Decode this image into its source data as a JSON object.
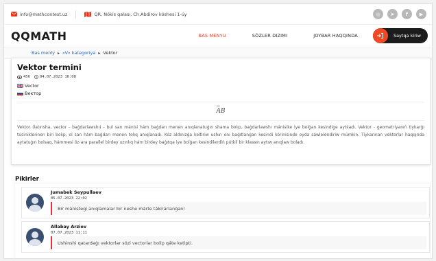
{
  "topbar": {
    "email": "info@mathcontest.uz",
    "address": "QR, Nókis qalası, Ch.Abdirov kóshesi 1-úy",
    "social": [
      "instagram-icon",
      "telegram-icon",
      "facebook-icon",
      "youtube-icon"
    ]
  },
  "header": {
    "logo": "QQMATH",
    "nav": [
      {
        "label": "BAS MENYU",
        "active": true
      },
      {
        "label": "SÓZLER DIZIMI",
        "active": false
      },
      {
        "label": "JOYBAR HAQQINDA",
        "active": false
      }
    ],
    "login_label": "Saytqa kiriw"
  },
  "breadcrumb": {
    "home": "Bas menly",
    "category": "«V» kategoriya",
    "current": "Vektor"
  },
  "term": {
    "title": "Vektor termini",
    "views": "456",
    "date": "04.07.2023 16:08",
    "translations": {
      "en": "Vector",
      "ru": "Вектор"
    },
    "formula": "AB",
    "description": "Vektor (latınsha, vector - baǵdarlawshı) - bul san mánisi hám baǵdarı menen anıqlanatuǵın shama bolıp, baǵdarlawshı mánisike iye bolǵan kesindige aytıladı. Vektor - geometriyanıń tiykarǵı túsiniklerinen biri bolıp, ol san hám baǵdarı menen tolıq anıqlanadı. Kóz aldınızǵa keltiriw ushın onı baǵıtlanǵan kesindi kórinisinde oyda sáwlelendiriw múmkin. Tiykarınan vektorlar haqqında aytatuǵın bolsaq, hámmesi óz-ara parallel birdey uzınlıq hám birdey baǵıtqa iye bolǵan kesindilerdiń pútkil bir klassın aytıw anıqlaw boladı."
  },
  "comments": {
    "title": "Pikirler",
    "items": [
      {
        "name": "Jumabek Seypullaev",
        "date": "05.07.2023 22:02",
        "text": "Bir mánistegi anıqlamalar bir neshe márte tákirarlanǵan!"
      },
      {
        "name": "Allabay Arziev",
        "date": "07.07.2023 11:11",
        "text": "Ushinshi qatardaǵı vektorlar sózi vectorlar bolip qáte ketipti."
      }
    ]
  },
  "colors": {
    "accent": "#e8341c",
    "link": "#1d64c8",
    "comment_border": "#e0303a",
    "dark_button": "#1c1c1c"
  }
}
